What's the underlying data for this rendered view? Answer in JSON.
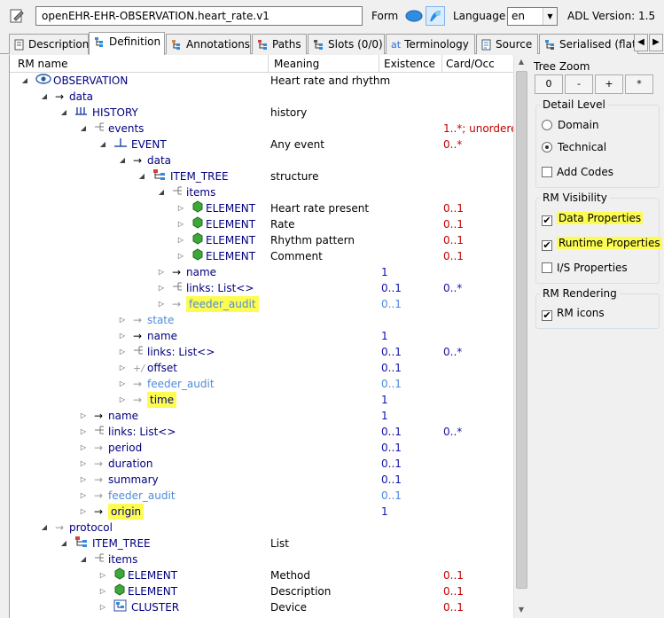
{
  "archetype_id": "openEHR-EHR-OBSERVATION.heart_rate.v1",
  "form_label": "Form",
  "language_label": "Language",
  "language_value": "en",
  "adl_version_label": "ADL Version:",
  "adl_version_value": "1.5",
  "tabs": [
    {
      "label": "Description",
      "icon": "description-icon",
      "active": false
    },
    {
      "label": "Definition",
      "icon": "definition-icon",
      "active": true
    },
    {
      "label": "Annotations",
      "icon": "annotations-icon",
      "active": false
    },
    {
      "label": "Paths",
      "icon": "paths-icon",
      "active": false
    },
    {
      "label": "Slots (0/0)",
      "icon": "slots-icon",
      "active": false
    },
    {
      "label": "Terminology",
      "icon": "terminology-icon",
      "active": false
    },
    {
      "label": "Source",
      "icon": "source-icon",
      "active": false
    },
    {
      "label": "Serialised (flat)",
      "icon": "serialised-icon",
      "active": false
    }
  ],
  "columns": {
    "rm_name": "RM name",
    "meaning": "Meaning",
    "existence": "Existence",
    "card_occ": "Card/Occ"
  },
  "tree_rows": [
    {
      "depth": 0,
      "twisty": "open",
      "icon": "observation-eye-icon",
      "label": "OBSERVATION",
      "style": "blue",
      "meaning": "Heart rate and rhythm",
      "existence": "",
      "card": "",
      "highlight": false
    },
    {
      "depth": 1,
      "twisty": "open",
      "icon": "arrow-icon",
      "label": "data",
      "style": "blue",
      "meaning": "",
      "existence": "",
      "card": "",
      "highlight": false
    },
    {
      "depth": 2,
      "twisty": "open",
      "icon": "history-icon",
      "label": "HISTORY",
      "style": "blue",
      "meaning": "history",
      "existence": "",
      "card": "",
      "highlight": false
    },
    {
      "depth": 3,
      "twisty": "open",
      "icon": "container-attr-icon",
      "label": "events",
      "style": "blue",
      "meaning": "",
      "existence": "",
      "card": "1..*; unordered",
      "highlight": false
    },
    {
      "depth": 4,
      "twisty": "open",
      "icon": "event-icon",
      "label": "EVENT",
      "style": "blue",
      "meaning": "Any event",
      "existence": "",
      "card": "0..*",
      "highlight": false
    },
    {
      "depth": 5,
      "twisty": "open",
      "icon": "arrow-icon",
      "label": "data",
      "style": "blue",
      "meaning": "",
      "existence": "",
      "card": "",
      "highlight": false
    },
    {
      "depth": 6,
      "twisty": "open",
      "icon": "item-tree-icon",
      "label": "ITEM_TREE",
      "style": "blue",
      "meaning": "structure",
      "existence": "",
      "card": "",
      "highlight": false
    },
    {
      "depth": 7,
      "twisty": "open",
      "icon": "container-attr-icon",
      "label": "items",
      "style": "blue",
      "meaning": "",
      "existence": "",
      "card": "",
      "highlight": false
    },
    {
      "depth": 8,
      "twisty": "closed",
      "icon": "element-icon",
      "label": "ELEMENT",
      "style": "blue",
      "meaning": "Heart rate present",
      "existence": "",
      "card": "0..1",
      "highlight": false
    },
    {
      "depth": 8,
      "twisty": "closed",
      "icon": "element-icon",
      "label": "ELEMENT",
      "style": "blue",
      "meaning": "Rate",
      "existence": "",
      "card": "0..1",
      "highlight": false
    },
    {
      "depth": 8,
      "twisty": "closed",
      "icon": "element-icon",
      "label": "ELEMENT",
      "style": "blue",
      "meaning": "Rhythm pattern",
      "existence": "",
      "card": "0..1",
      "highlight": false
    },
    {
      "depth": 8,
      "twisty": "closed",
      "icon": "element-icon",
      "label": "ELEMENT",
      "style": "blue",
      "meaning": "Comment",
      "existence": "",
      "card": "0..1",
      "highlight": false
    },
    {
      "depth": 7,
      "twisty": "closed",
      "icon": "arrow-icon",
      "label": "name",
      "style": "blue",
      "meaning": "",
      "existence": "1",
      "card": "",
      "highlight": false
    },
    {
      "depth": 7,
      "twisty": "closed",
      "icon": "container-attr-icon",
      "label": "links: List<>",
      "style": "blue",
      "meaning": "",
      "existence": "0..1",
      "card": "0..*",
      "highlight": false
    },
    {
      "depth": 7,
      "twisty": "closed",
      "icon": "faded-arrow-icon",
      "label": "feeder_audit",
      "style": "faded",
      "meaning": "",
      "existence": "0..1",
      "card": "",
      "highlight": true
    },
    {
      "depth": 5,
      "twisty": "closed",
      "icon": "faded-arrow-icon",
      "label": "state",
      "style": "faded",
      "meaning": "",
      "existence": "",
      "card": "",
      "highlight": false
    },
    {
      "depth": 5,
      "twisty": "closed",
      "icon": "arrow-icon",
      "label": "name",
      "style": "blue",
      "meaning": "",
      "existence": "1",
      "card": "",
      "highlight": false
    },
    {
      "depth": 5,
      "twisty": "closed",
      "icon": "container-attr-icon",
      "label": "links: List<>",
      "style": "blue",
      "meaning": "",
      "existence": "0..1",
      "card": "0..*",
      "highlight": false
    },
    {
      "depth": 5,
      "twisty": "closed",
      "icon": "offset-icon",
      "label": "offset",
      "style": "blue",
      "meaning": "",
      "existence": "0..1",
      "card": "",
      "highlight": false
    },
    {
      "depth": 5,
      "twisty": "closed",
      "icon": "faded-arrow-icon",
      "label": "feeder_audit",
      "style": "faded",
      "meaning": "",
      "existence": "0..1",
      "card": "",
      "highlight": false
    },
    {
      "depth": 5,
      "twisty": "closed",
      "icon": "faded-arrow-icon",
      "label": "time",
      "style": "blue",
      "meaning": "",
      "existence": "1",
      "card": "",
      "highlight": true
    },
    {
      "depth": 3,
      "twisty": "closed",
      "icon": "arrow-icon",
      "label": "name",
      "style": "blue",
      "meaning": "",
      "existence": "1",
      "card": "",
      "highlight": false
    },
    {
      "depth": 3,
      "twisty": "closed",
      "icon": "container-attr-icon",
      "label": "links: List<>",
      "style": "blue",
      "meaning": "",
      "existence": "0..1",
      "card": "0..*",
      "highlight": false
    },
    {
      "depth": 3,
      "twisty": "closed",
      "icon": "faded-arrow-icon",
      "label": "period",
      "style": "blue",
      "meaning": "",
      "existence": "0..1",
      "card": "",
      "highlight": false
    },
    {
      "depth": 3,
      "twisty": "closed",
      "icon": "faded-arrow-icon",
      "label": "duration",
      "style": "blue",
      "meaning": "",
      "existence": "0..1",
      "card": "",
      "highlight": false
    },
    {
      "depth": 3,
      "twisty": "closed",
      "icon": "faded-arrow-icon",
      "label": "summary",
      "style": "blue",
      "meaning": "",
      "existence": "0..1",
      "card": "",
      "highlight": false
    },
    {
      "depth": 3,
      "twisty": "closed",
      "icon": "faded-arrow-icon",
      "label": "feeder_audit",
      "style": "faded",
      "meaning": "",
      "existence": "0..1",
      "card": "",
      "highlight": false
    },
    {
      "depth": 3,
      "twisty": "closed",
      "icon": "arrow-icon",
      "label": "origin",
      "style": "blue",
      "meaning": "",
      "existence": "1",
      "card": "",
      "highlight": true
    },
    {
      "depth": 1,
      "twisty": "open",
      "icon": "faded-arrow-icon",
      "label": "protocol",
      "style": "blue",
      "meaning": "",
      "existence": "",
      "card": "",
      "highlight": false
    },
    {
      "depth": 2,
      "twisty": "open",
      "icon": "item-tree-icon",
      "label": "ITEM_TREE",
      "style": "blue",
      "meaning": "List",
      "existence": "",
      "card": "",
      "highlight": false
    },
    {
      "depth": 3,
      "twisty": "open",
      "icon": "container-attr-icon",
      "label": "items",
      "style": "blue",
      "meaning": "",
      "existence": "",
      "card": "",
      "highlight": false
    },
    {
      "depth": 4,
      "twisty": "closed",
      "icon": "element-icon",
      "label": "ELEMENT",
      "style": "blue",
      "meaning": "Method",
      "existence": "",
      "card": "0..1",
      "highlight": false
    },
    {
      "depth": 4,
      "twisty": "closed",
      "icon": "element-icon",
      "label": "ELEMENT",
      "style": "blue",
      "meaning": "Description",
      "existence": "",
      "card": "0..1",
      "highlight": false
    },
    {
      "depth": 4,
      "twisty": "closed",
      "icon": "cluster-icon",
      "label": "CLUSTER",
      "style": "blue",
      "meaning": "Device",
      "existence": "",
      "card": "0..1",
      "highlight": false
    }
  ],
  "tree_zoom": {
    "title": "Tree Zoom",
    "buttons": [
      "0",
      "-",
      "+",
      "*"
    ]
  },
  "detail_level": {
    "title": "Detail Level",
    "options": [
      {
        "label": "Domain",
        "selected": false
      },
      {
        "label": "Technical",
        "selected": true
      }
    ],
    "add_codes": {
      "label": "Add Codes",
      "checked": false
    }
  },
  "rm_visibility": {
    "title": "RM Visibility",
    "options": [
      {
        "label": "Data Properties",
        "checked": true,
        "highlight": true
      },
      {
        "label": "Runtime Properties",
        "checked": true,
        "highlight": true
      },
      {
        "label": "I/S Properties",
        "checked": false,
        "highlight": false
      }
    ]
  },
  "rm_rendering": {
    "title": "RM Rendering",
    "options": [
      {
        "label": "RM icons",
        "checked": true
      }
    ]
  },
  "colors": {
    "node_text": "#00007f",
    "faded_text": "#4f8bd8",
    "card_text": "#c00000",
    "existence_text": "#1414a8",
    "highlight": "#fcfc52"
  }
}
